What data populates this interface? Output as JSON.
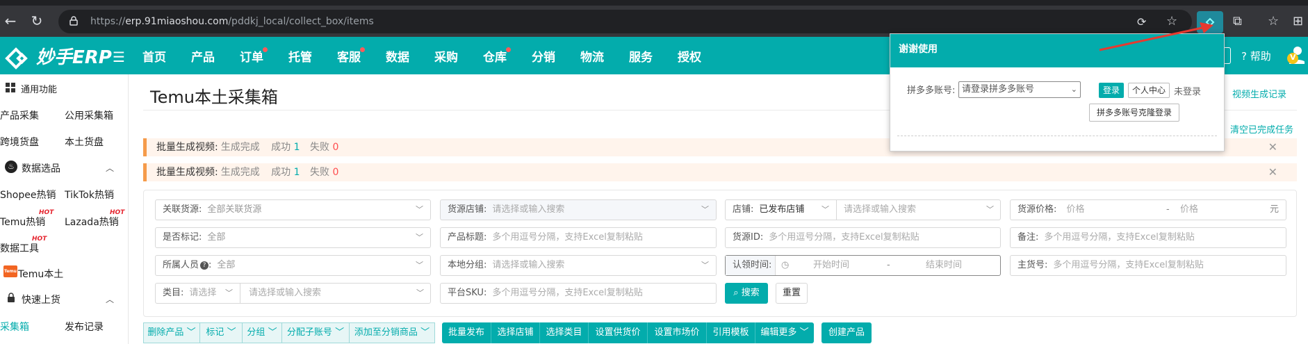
{
  "browser": {
    "url_scheme": "https://",
    "url_host": "erp.91miaoshou.com",
    "url_path": "/pddkj_local/collect_box/items"
  },
  "header": {
    "logo_text": "妙手ERP",
    "nav": [
      "首页",
      "产品",
      "订单",
      "托管",
      "客服",
      "数据",
      "采购",
      "仓库",
      "分销",
      "物流",
      "服务",
      "授权"
    ],
    "help_label": "帮助",
    "avatar_initial": "V"
  },
  "sidebar": {
    "common": "通用功能",
    "product_collect": "产品采集",
    "public_collect": "公用采集箱",
    "cross_border": "跨境货盘",
    "local": "本土货盘",
    "data_select": "数据选品",
    "shopee_hot": "Shopee热销",
    "tiktok_hot": "TikTok热销",
    "temu_hot": "Temu热销",
    "lazada_hot": "Lazada热销",
    "data_tools": "数据工具",
    "hot_badge": "HOT",
    "temu_local": "Temu本土",
    "temu_local_icon": "Temu",
    "quick_listing": "快速上货",
    "collect_box": "采集箱",
    "publish_record": "发布记录"
  },
  "main": {
    "title": "Temu本土采集箱",
    "video_records_link": "视频生成记录",
    "clear_done_link": "清空已完成任务",
    "notices": [
      {
        "label": "批量生成视频:",
        "status": "生成完成",
        "success_label": "成功",
        "success_count": "1",
        "fail_label": "失败",
        "fail_count": "0"
      },
      {
        "label": "批量生成视频:",
        "status": "生成完成",
        "success_label": "成功",
        "success_count": "1",
        "fail_label": "失败",
        "fail_count": "0"
      }
    ]
  },
  "filters": {
    "related_source_label": "关联货源:",
    "related_source_value": "全部关联货源",
    "source_shop_label": "货源店铺:",
    "source_shop_placeholder": "请选择或输入搜索",
    "shop_label": "店铺:",
    "shop_value": "已发布店铺",
    "shop_search_placeholder": "请选择或输入搜索",
    "source_price_label": "货源价格:",
    "price_min_placeholder": "价格",
    "price_sep": "-",
    "price_max_placeholder": "价格",
    "price_unit": "元",
    "marked_label": "是否标记:",
    "marked_value": "全部",
    "product_title_label": "产品标题:",
    "product_title_placeholder": "多个用逗号分隔，支持Excel复制粘贴",
    "source_id_label": "货源ID:",
    "source_id_placeholder": "多个用逗号分隔，支持Excel复制粘贴",
    "remark_label": "备注:",
    "remark_placeholder": "多个用逗号分隔，支持Excel复制粘贴",
    "owner_label": "所属人员",
    "owner_value": "全部",
    "local_group_label": "本地分组:",
    "local_group_placeholder": "请选择或输入搜索",
    "claim_time_label": "认领时间:",
    "start_time_placeholder": "开始时间",
    "time_sep": "-",
    "end_time_placeholder": "结束时间",
    "main_sku_label": "主货号:",
    "main_sku_placeholder": "多个用逗号分隔，支持Excel复制粘贴",
    "category_label": "类目:",
    "category_value": "请选择",
    "category_search_placeholder": "请选择或输入搜索",
    "platform_sku_label": "平台SKU:",
    "platform_sku_placeholder": "多个用逗号分隔，支持Excel复制粘贴",
    "search_button": "搜索",
    "reset_button": "重置"
  },
  "toolbar": {
    "group_actions": [
      "删除产品",
      "标记",
      "分组",
      "分配子账号",
      "添加至分销商品"
    ],
    "primary_actions": [
      "批量发布",
      "选择店铺",
      "选择类目",
      "设置供货价",
      "设置市场价",
      "引用模板",
      "编辑更多"
    ],
    "create_product": "创建产品"
  },
  "popup": {
    "title": "谢谢使用",
    "account_label": "拼多多账号:",
    "account_select": "请登录拼多多账号",
    "login_button": "登录",
    "personal_center_button": "个人中心",
    "login_status": "未登录",
    "clone_login_button": "拼多多账号克隆登录"
  }
}
